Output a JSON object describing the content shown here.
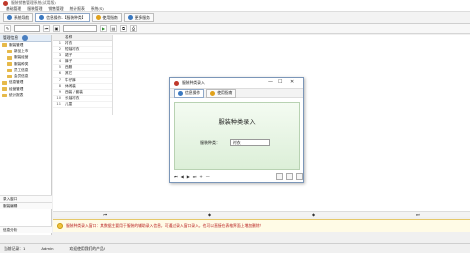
{
  "window": {
    "title": "服装销售管理系统(试用版)"
  },
  "menu": [
    "基础管理",
    "服装管理",
    "销售管理",
    "统计报表",
    "系统(S)"
  ],
  "tabs": [
    {
      "label": "系统导航",
      "icon": "home-icon",
      "color": "#3a78c0"
    },
    {
      "label": "信息操作-【服装种类】",
      "icon": "document-icon",
      "color": "#3a78c0",
      "active": true
    },
    {
      "label": "使用指南",
      "icon": "help-icon",
      "color": "#e0a11b"
    },
    {
      "label": "更多服务",
      "icon": "gear-icon",
      "color": "#3a78c0"
    }
  ],
  "sidebar": {
    "header": "管理信息",
    "items": [
      "服装管理",
      "新品上市",
      "服装经营",
      "服装种类",
      "员工信息",
      "会员信息",
      "信息管理",
      "经营管理",
      "统计报表"
    ],
    "footer_items": [
      "录入窗口",
      "服装编辑"
    ],
    "bottom": "信息分析"
  },
  "grid": {
    "header": "名称",
    "rows": [
      {
        "id": "1",
        "name": "衬衣"
      },
      {
        "id": "2",
        "name": "短袖衬衣"
      },
      {
        "id": "3",
        "name": "裙子"
      },
      {
        "id": "4",
        "name": "裤子"
      },
      {
        "id": "5",
        "name": "西服"
      },
      {
        "id": "6",
        "name": "其它"
      },
      {
        "id": "7",
        "name": "牛仔裤"
      },
      {
        "id": "8",
        "name": "休闲装"
      },
      {
        "id": "9",
        "name": "西装 / 套装"
      },
      {
        "id": "10",
        "name": "长袖衬衣"
      },
      {
        "id": "11",
        "name": "儿童"
      }
    ]
  },
  "hint": "服装种类录入窗口：其数据主要用于服装的辅助录入信息，可通过录入窗口录入，也可以直接在表格界面上增加删除！",
  "status": {
    "user": "当前记录：1",
    "admin": "Admin",
    "welcome": "欢迎使用我们的产品!"
  },
  "dialog": {
    "title": "服装种类录入",
    "tabs": [
      "信息操作",
      "使用指南"
    ],
    "heading": "服装种类录入",
    "field_label": "服装种类：",
    "field_value": "衬衣"
  }
}
